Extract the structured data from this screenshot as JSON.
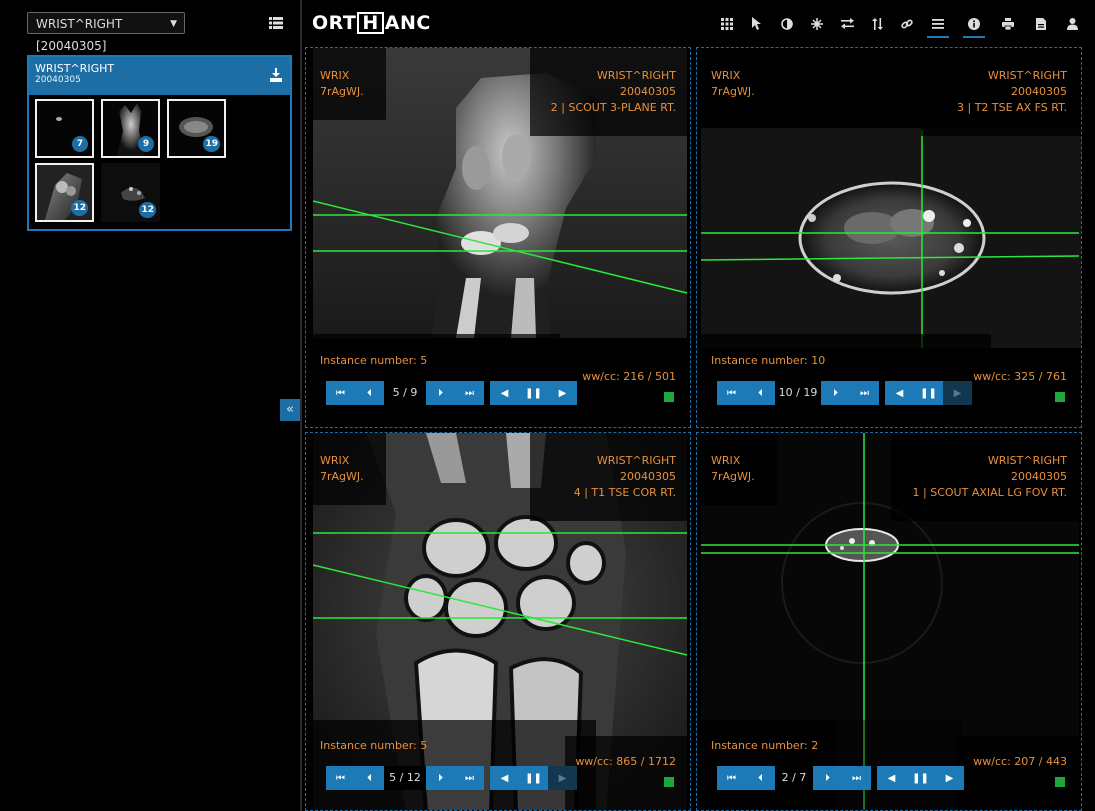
{
  "app": {
    "logo_left": "ORT",
    "logo_mid": "H",
    "logo_right": "ANC"
  },
  "sidebar": {
    "study_select": "WRIST^RIGHT [20040305]",
    "study": {
      "name": "WRIST^RIGHT",
      "date": "20040305"
    },
    "thumbnails": [
      {
        "count": "7",
        "selected": true
      },
      {
        "count": "9",
        "selected": true
      },
      {
        "count": "19",
        "selected": true
      },
      {
        "count": "12",
        "selected": true
      },
      {
        "count": "12",
        "selected": false
      }
    ],
    "collapse_label": "«"
  },
  "toolbar": {
    "icons": [
      "layout-grid-icon",
      "pointer-icon",
      "contrast-icon",
      "crosshair-icon",
      "swap-icon",
      "sort-icon",
      "link-icon",
      "menu-icon",
      "info-icon",
      "print-icon",
      "file-icon",
      "user-icon"
    ],
    "accent": "#1c7bb6"
  },
  "viewports": [
    {
      "patient": "WRIX",
      "patient_id": "7rAgWJ.",
      "study": "WRIST^RIGHT",
      "date": "20040305",
      "series": "2 | SCOUT 3-PLANE RT.",
      "instance": "Instance number: 5",
      "frame": "5 / 9",
      "wwcc": "ww/cc: 216 / 501"
    },
    {
      "patient": "WRIX",
      "patient_id": "7rAgWJ.",
      "study": "WRIST^RIGHT",
      "date": "20040305",
      "series": "3 | T2 TSE AX FS RT.",
      "instance": "Instance number: 10",
      "frame": "10 / 19",
      "wwcc": "ww/cc: 325 / 761"
    },
    {
      "patient": "WRIX",
      "patient_id": "7rAgWJ.",
      "study": "WRIST^RIGHT",
      "date": "20040305",
      "series": "4 | T1 TSE COR RT.",
      "instance": "Instance number: 5",
      "frame": "5 / 12",
      "wwcc": "ww/cc: 865 / 1712"
    },
    {
      "patient": "WRIX",
      "patient_id": "7rAgWJ.",
      "study": "WRIST^RIGHT",
      "date": "20040305",
      "series": "1 | SCOUT AXIAL LG FOV RT.",
      "instance": "Instance number: 2",
      "frame": "2 / 7",
      "wwcc": "ww/cc: 207 / 443"
    }
  ],
  "colors": {
    "overlay_text": "#e8903c",
    "reference_lines": "#2ee63c",
    "status": "#1ea63f"
  }
}
